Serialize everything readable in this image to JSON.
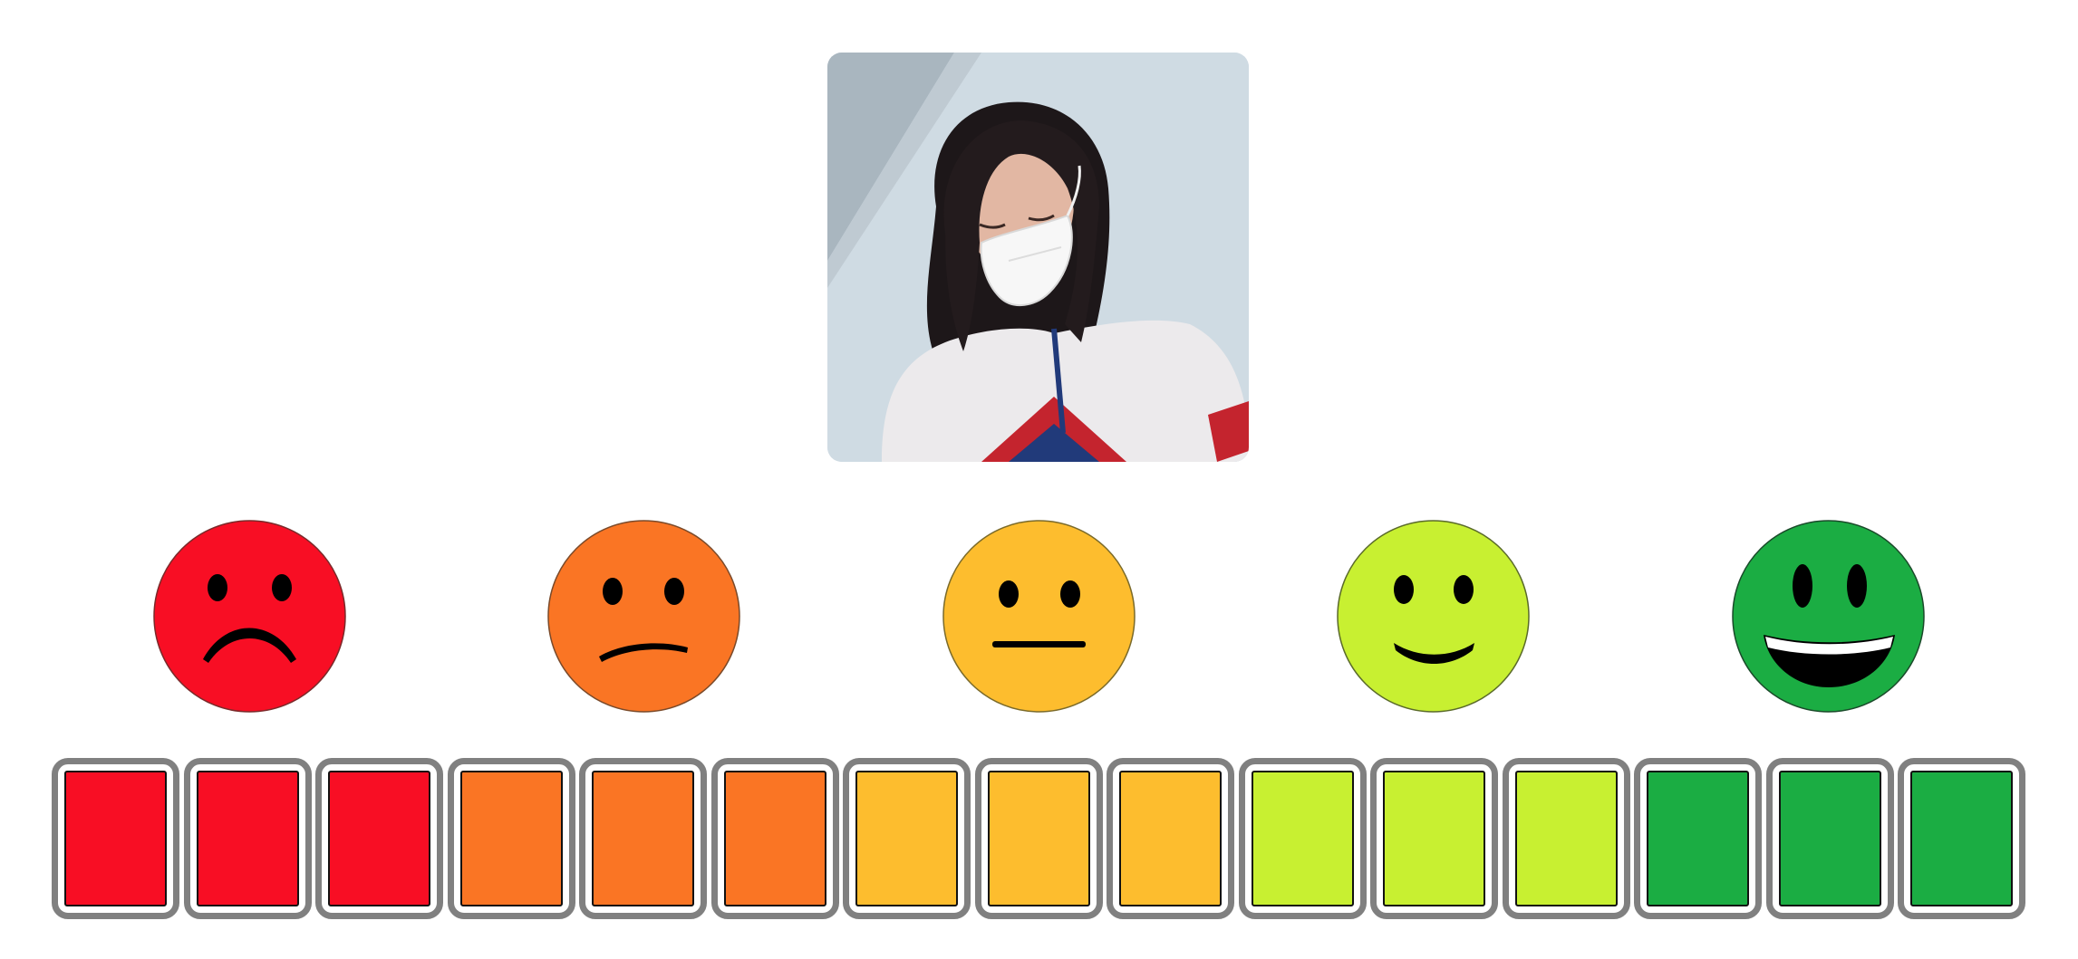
{
  "photo": {
    "alt_subject": "person-wearing-face-mask-looking-down"
  },
  "faces": [
    {
      "name": "very-sad",
      "icon": "very-sad-face-icon",
      "color": "#F80E24"
    },
    {
      "name": "sad",
      "icon": "sad-face-icon",
      "color": "#FA7524"
    },
    {
      "name": "neutral",
      "icon": "neutral-face-icon",
      "color": "#FDBD2E"
    },
    {
      "name": "happy",
      "icon": "happy-face-icon",
      "color": "#C8F031"
    },
    {
      "name": "very-happy",
      "icon": "very-happy-face-icon",
      "color": "#1BAD43"
    }
  ],
  "scale": {
    "cell_count": 15,
    "cell_colors": [
      "#F80E24",
      "#F80E24",
      "#F80E24",
      "#FA7524",
      "#FA7524",
      "#FA7524",
      "#FDBD2E",
      "#FDBD2E",
      "#FDBD2E",
      "#C8F031",
      "#C8F031",
      "#C8F031",
      "#1BAD43",
      "#1BAD43",
      "#1BAD43"
    ]
  }
}
